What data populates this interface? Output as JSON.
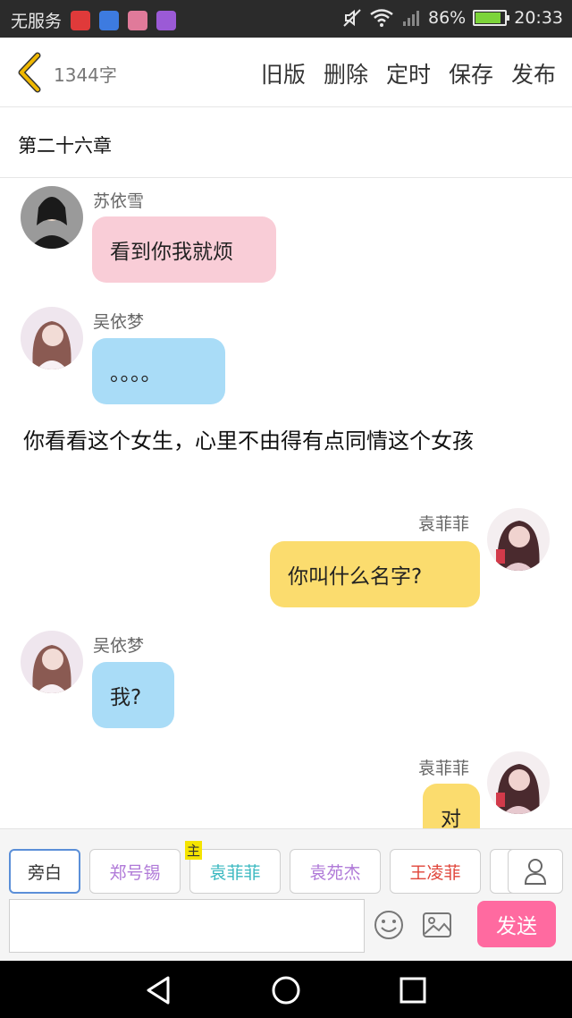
{
  "status_bar": {
    "carrier": "无服务",
    "battery": "86%",
    "battery_level": 0.86,
    "time": "20:33",
    "app_icon_colors": [
      "#e03a3a",
      "#3d7be0",
      "#e07a9a",
      "#9b5ad6"
    ]
  },
  "header": {
    "word_count": "1344字",
    "actions": [
      "旧版",
      "删除",
      "定时",
      "保存",
      "发布"
    ]
  },
  "chapter_title": "第二十六章",
  "messages": [
    {
      "side": "left",
      "sender": "苏依雪",
      "text": "看到你我就烦",
      "color": "#f9cdd7",
      "avatar_color": "#2a2a2a"
    },
    {
      "side": "left",
      "sender": "吴依梦",
      "text": "。。。。",
      "color": "#a9dcf7",
      "avatar_color": "#d7b8c7"
    },
    {
      "side": "right",
      "sender": "袁菲菲",
      "text": "你叫什么名字?",
      "color": "#fbdc6e",
      "avatar_color": "#c99aa6"
    },
    {
      "side": "left",
      "sender": "吴依梦",
      "text": "我?",
      "color": "#a9dcf7",
      "avatar_color": "#d7b8c7"
    },
    {
      "side": "right",
      "sender": "袁菲菲",
      "text": "对",
      "color": "#fbdc6e",
      "avatar_color": "#c99aa6"
    }
  ],
  "narration": "你看看这个女生，心里不由得有点同情这个女孩",
  "roles": [
    {
      "name": "旁白",
      "color": "#333333"
    },
    {
      "name": "郑号锡",
      "color": "#b07ad8"
    },
    {
      "name": "袁菲菲",
      "color": "#3ab8c0"
    },
    {
      "name": "袁苑杰",
      "color": "#b07ad8"
    },
    {
      "name": "王凌菲",
      "color": "#e0453a"
    }
  ],
  "main_badge": "主",
  "input_placeholder": "",
  "send_label": "发送",
  "accent_colors": {
    "send": "#ff6aa0",
    "selected_role_border": "#5b8fd8",
    "back_arrow": "#f0b800"
  }
}
